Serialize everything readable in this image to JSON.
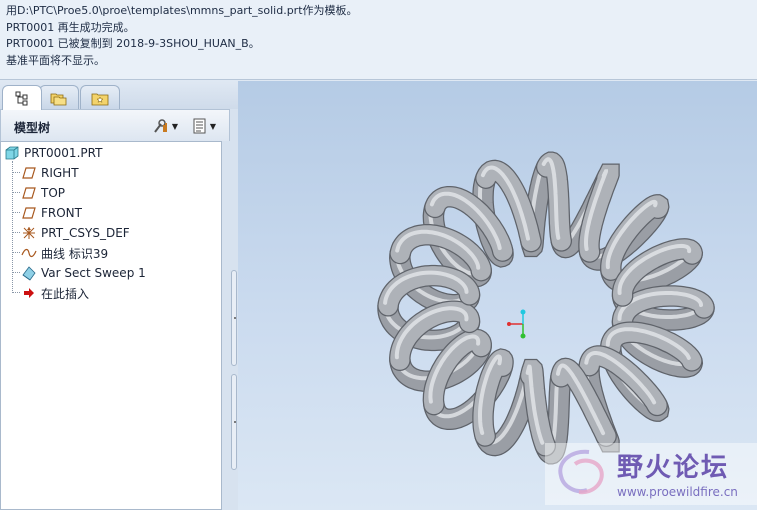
{
  "message_area": {
    "lines": [
      "用D:\\PTC\\Proe5.0\\proe\\templates\\mmns_part_solid.prt作为模板。",
      "PRT0001 再生成功完成。",
      "PRT0001 已被复制到 2018-9-3SHOU_HUAN_B。",
      "基准平面将不显示。"
    ]
  },
  "navigator": {
    "tabs": [
      {
        "name": "model-tree-tab",
        "icon": "tree-icon",
        "active": true
      },
      {
        "name": "folder-browser-tab",
        "icon": "folder-icon",
        "active": false
      },
      {
        "name": "favorites-tab",
        "icon": "favorites-icon",
        "active": false
      }
    ],
    "title": "模型树",
    "tree": [
      {
        "label": "PRT0001.PRT",
        "icon": "part-icon",
        "indent": 0
      },
      {
        "label": "RIGHT",
        "icon": "datum-plane-icon",
        "indent": 1
      },
      {
        "label": "TOP",
        "icon": "datum-plane-icon",
        "indent": 1
      },
      {
        "label": "FRONT",
        "icon": "datum-plane-icon",
        "indent": 1
      },
      {
        "label": "PRT_CSYS_DEF",
        "icon": "csys-icon",
        "indent": 1
      },
      {
        "label": "曲线 标识39",
        "icon": "curve-icon",
        "indent": 1
      },
      {
        "label": "Var Sect Sweep 1",
        "icon": "sweep-icon",
        "indent": 1
      },
      {
        "label": "在此插入",
        "icon": "insert-arrow-icon",
        "indent": 1
      }
    ]
  },
  "graphics": {
    "model": "helical-coil-torus",
    "coil_turns": 16,
    "background_top": "#b5cbe5",
    "background_bottom": "#dbe7f4"
  },
  "watermark": {
    "title": "野火论坛",
    "url": "www.proewildfire.cn"
  },
  "colors": {
    "message_bg": "#e9f0f8",
    "tree_bg": "#ffffff",
    "coil": "#a7abb2",
    "csys_x": "#e03030",
    "csys_y": "#20c8e0",
    "csys_z": "#30c030",
    "insert_arrow": "#cc1010"
  }
}
